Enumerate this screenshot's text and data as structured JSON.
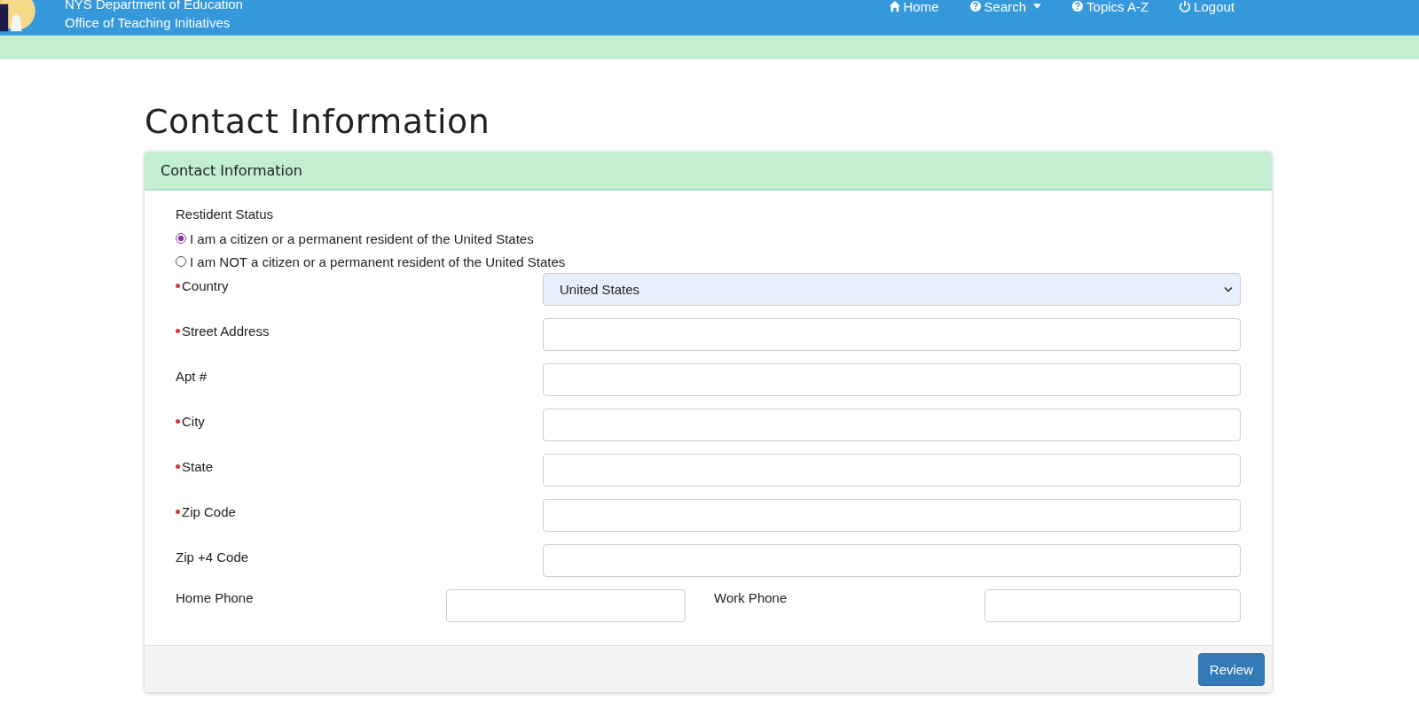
{
  "header": {
    "line_1": "NYS Department of Education",
    "line_2": "Office of Teaching Initiatives",
    "nav": [
      {
        "label": "Home",
        "kind": "home",
        "dropdown": false
      },
      {
        "label": "Search",
        "kind": "help",
        "dropdown": true
      },
      {
        "label": "Topics A-Z",
        "kind": "help",
        "dropdown": false
      },
      {
        "label": "Logout",
        "kind": "logout",
        "dropdown": false
      }
    ]
  },
  "page_title": "Contact Information",
  "panel": {
    "title": "Contact Information",
    "resident_status": {
      "label": "Restident Status",
      "options": [
        {
          "label": "I am a citizen or a permanent resident of the United States",
          "selected": true
        },
        {
          "label": "I am NOT a citizen or a permanent resident of the United States",
          "selected": false
        }
      ]
    },
    "fields": [
      {
        "label": "Country",
        "required": true,
        "kind": "select",
        "value": "United States"
      },
      {
        "label": "Street Address",
        "required": true,
        "kind": "text"
      },
      {
        "label": "Apt #",
        "required": false,
        "kind": "text"
      },
      {
        "label": "City",
        "required": true,
        "kind": "text"
      },
      {
        "label": "State",
        "required": true,
        "kind": "text"
      },
      {
        "label": "Zip Code",
        "required": true,
        "kind": "text"
      },
      {
        "label": "Zip +4 Code",
        "required": false,
        "kind": "text"
      }
    ],
    "phones": [
      {
        "label": "Home Phone"
      },
      {
        "label": "Work Phone"
      }
    ],
    "review_button": "Review"
  }
}
